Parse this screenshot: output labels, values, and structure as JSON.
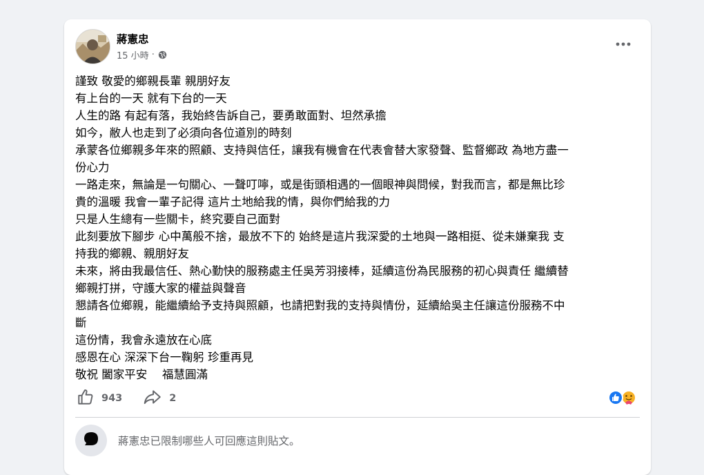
{
  "post": {
    "author": "蔣憲忠",
    "time": "15 小時",
    "separator": "·",
    "audience_icon": "globe-icon",
    "more_icon": "more-options-icon",
    "lines": [
      "謹致 敬愛的鄉親長輩 親朋好友",
      "有上台的一天 就有下台的一天",
      "人生的路 有起有落，我始終告訴自己，要勇敢面對、坦然承擔",
      "如今，敝人也走到了必須向各位道別的時刻",
      "承蒙各位鄉親多年來的照顧、支持與信任，讓我有機會在代表會替大家發聲、監督鄉政 為地方盡一",
      "份心力",
      "一路走來，無論是一句關心、一聲叮嚀，或是街頭相遇的一個眼神與問候，對我而言，都是無比珍",
      "貴的溫暖 我會一輩子記得 這片土地給我的情，與你們給我的力",
      "只是人生總有一些關卡，終究要自己面對",
      "此刻要放下腳步 心中萬般不捨，最放不下的 始終是這片我深愛的土地與一路相挺、從未嫌棄我 支",
      "持我的鄉親、親朋好友",
      "未來，將由我最信任、熱心勤快的服務處主任吳芳羽接棒，延續這份為民服務的初心與責任 繼續替",
      "鄉親打拼，守護大家的權益與聲音",
      "懇請各位鄉親，能繼續給予支持與照顧，也請把對我的支持與情份，延續給吳主任讓這份服務不中",
      "斷",
      "這份情，我會永遠放在心底",
      "感恩在心 深深下台一鞠躬 珍重再見",
      "敬祝 闔家平安　 福慧圓滿"
    ]
  },
  "actions": {
    "like_icon": "like-icon",
    "like_count": "943",
    "share_icon": "share-icon",
    "share_count": "2"
  },
  "reactions": {
    "icons": [
      "like-reaction-icon",
      "care-reaction-icon"
    ],
    "colors": {
      "like": "#1877f2",
      "care": "#f7b125"
    }
  },
  "comments": {
    "restricted_message": "蔣憲忠已限制哪些人可回應這則貼文。"
  },
  "colors": {
    "background": "#f0f2f5",
    "card": "#ffffff",
    "secondary_text": "#65676b"
  }
}
